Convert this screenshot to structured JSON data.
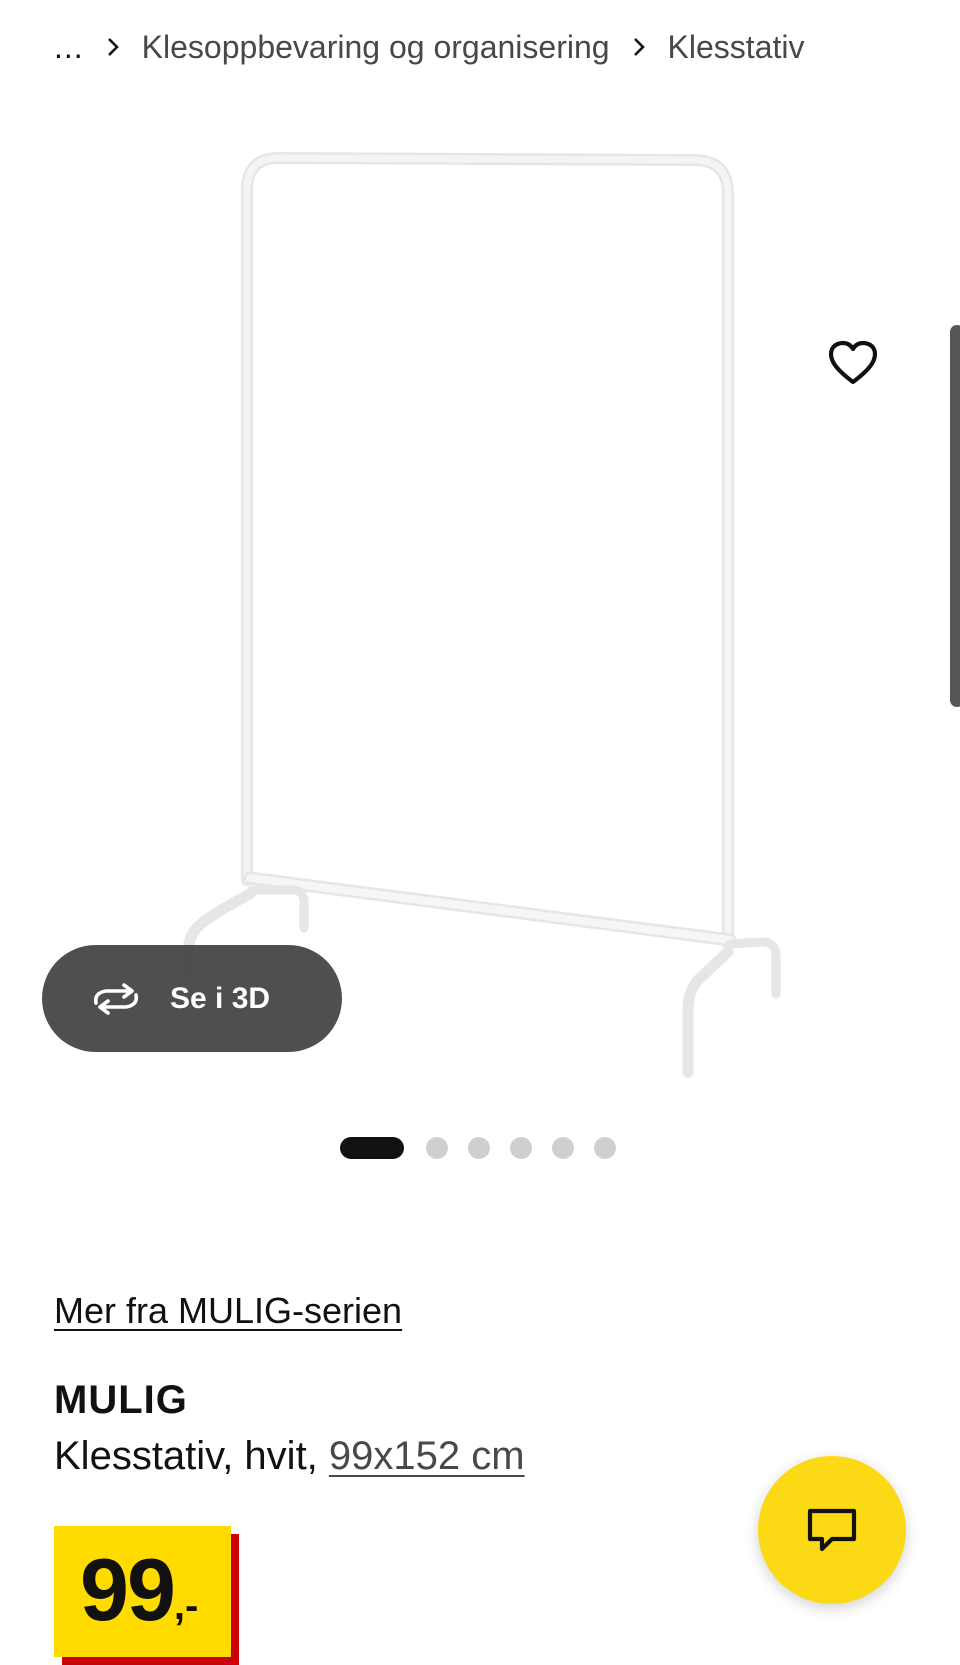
{
  "breadcrumb": {
    "ellipsis": "...",
    "items": [
      "Klesoppbevaring og organisering",
      "Klesstativ"
    ]
  },
  "gallery": {
    "image_alt": "MULIG klesstativ, hvit",
    "view_3d_label": "Se i 3D",
    "slide_count": 6,
    "active_slide": 1
  },
  "product": {
    "series_link": "Mer fra MULIG-serien",
    "name": "MULIG",
    "description": "Klesstativ, hvit, ",
    "size": "99x152 cm",
    "price_integer": "99",
    "price_decimal": ",-"
  },
  "colors": {
    "price_bg": "#ffdb00",
    "price_shadow": "#cc0008",
    "chat_button": "#fbd914",
    "button_3d": "#484848"
  },
  "icons": {
    "favorite": "heart-outline-icon",
    "view_3d": "rotate-3d-icon",
    "chat": "chat-bubble-icon",
    "breadcrumb_separator": "chevron-right-icon"
  }
}
